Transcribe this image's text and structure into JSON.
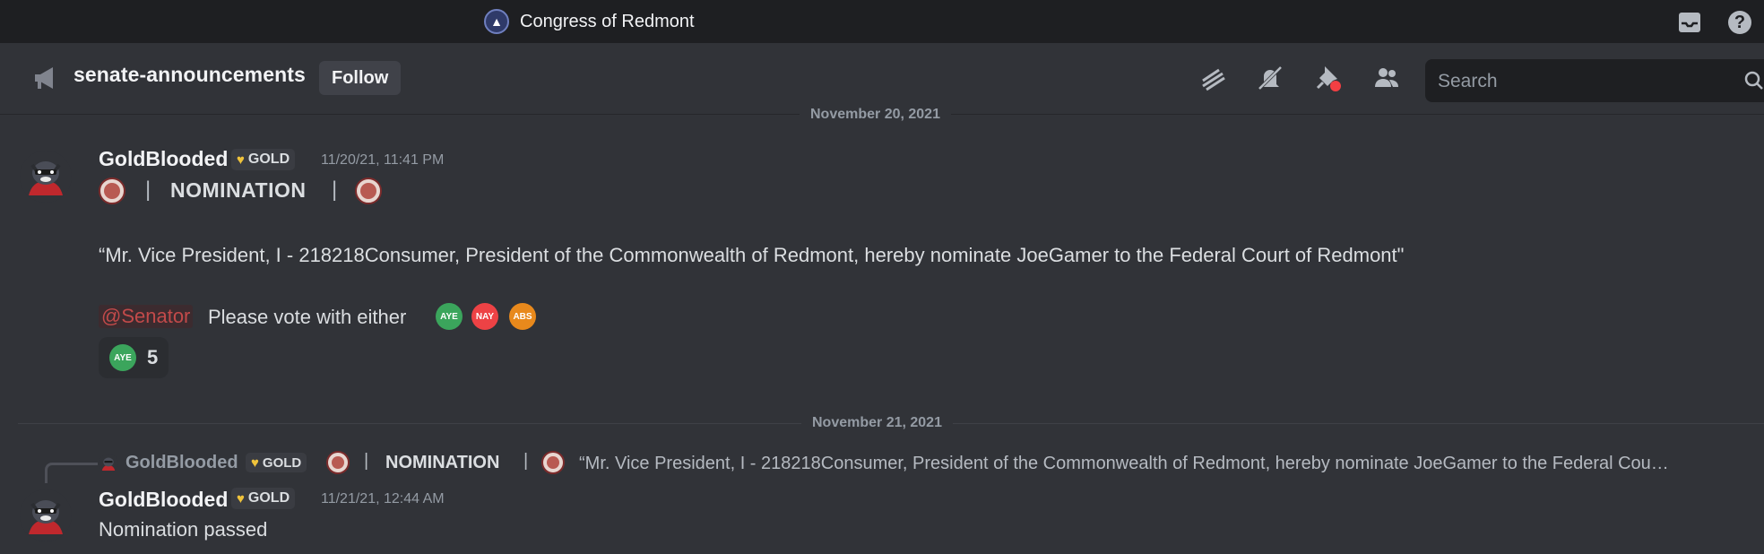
{
  "titlebar": {
    "server_name": "Congress of Redmont",
    "server_icon": "capitol-icon",
    "inbox_icon": "inbox-icon",
    "help_icon": "help-icon"
  },
  "channel": {
    "icon": "megaphone-icon",
    "name": "senate-announcements",
    "follow_label": "Follow",
    "header_icons": [
      "threads-icon",
      "mute-bell-icon",
      "pin-icon",
      "members-icon"
    ],
    "search_placeholder": "Search",
    "search_icon": "search-icon"
  },
  "dividers": {
    "top": "November 20, 2021",
    "middle": "November 21, 2021"
  },
  "messages": [
    {
      "author": "GoldBlooded",
      "badge": "GOLD",
      "timestamp": "11/20/21, 11:41 PM",
      "header_sep": "|",
      "header_title": "NOMINATION",
      "quote": "“Mr.  Vice President, I - 218218Consumer, President of the Commonwealth of Redmont, hereby nominate JoeGamer to the Federal Court of Redmont\"",
      "mention": "@Senator",
      "vote_prompt": "Please vote with either",
      "vote_options": [
        {
          "label": "AYE",
          "color": "#3ba55c"
        },
        {
          "label": "NAY",
          "color": "#ed4245"
        },
        {
          "label": "ABS",
          "color": "#e8891c"
        }
      ],
      "reaction": {
        "label": "AYE",
        "count": "5",
        "color": "#3ba55c"
      }
    },
    {
      "reply": {
        "author": "GoldBlooded",
        "badge": "GOLD",
        "sep": "|",
        "title": "NOMINATION",
        "text": "“Mr.  Vice President, I - 218218Consumer, President of the Commonwealth of Redmont, hereby nominate JoeGamer to the Federal Cou…"
      },
      "author": "GoldBlooded",
      "badge": "GOLD",
      "timestamp": "11/21/21, 12:44 AM",
      "text": "Nomination passed"
    }
  ],
  "colors": {
    "background": "#313338",
    "titlebar": "#1e1f22",
    "aye": "#3ba55c",
    "nay": "#ed4245",
    "abs": "#e8891c",
    "mention_text": "#c24a4a"
  }
}
